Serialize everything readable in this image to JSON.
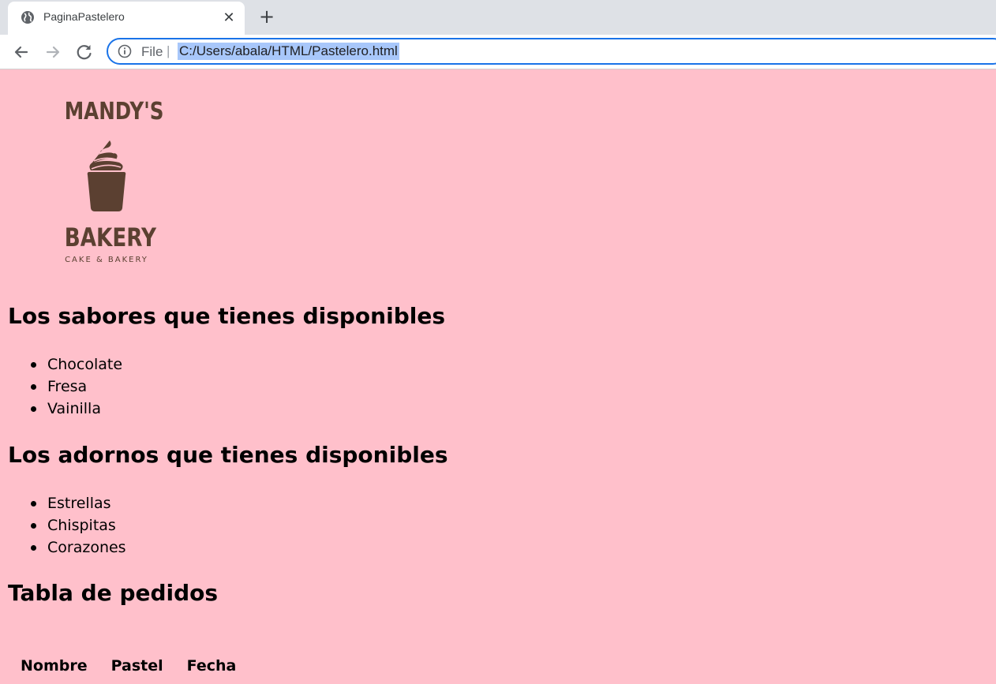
{
  "browser": {
    "tab_title": "PaginaPastelero",
    "tab_close": "✕",
    "new_tab": "+",
    "address_scheme": "File",
    "address_separator": "|",
    "address_url": "C:/Users/abala/HTML/Pastelero.html"
  },
  "logo": {
    "top_text": "MANDY'S",
    "middle_text": "BAKERY",
    "subtitle": "CAKE & BAKERY",
    "color": "#5b4031"
  },
  "flavors": {
    "heading": "Los sabores que tienes disponibles",
    "items": [
      "Chocolate",
      "Fresa",
      "Vainilla"
    ]
  },
  "toppings": {
    "heading": "Los adornos que tienes disponibles",
    "items": [
      "Estrellas",
      "Chispitas",
      "Corazones"
    ]
  },
  "orders": {
    "heading": "Tabla de pedidos",
    "columns": [
      "Nombre",
      "Pastel",
      "Fecha"
    ]
  },
  "colors": {
    "page_background": "#ffc0cb",
    "omnibox_border": "#1a73e8",
    "url_selection": "#a8c7fa"
  }
}
